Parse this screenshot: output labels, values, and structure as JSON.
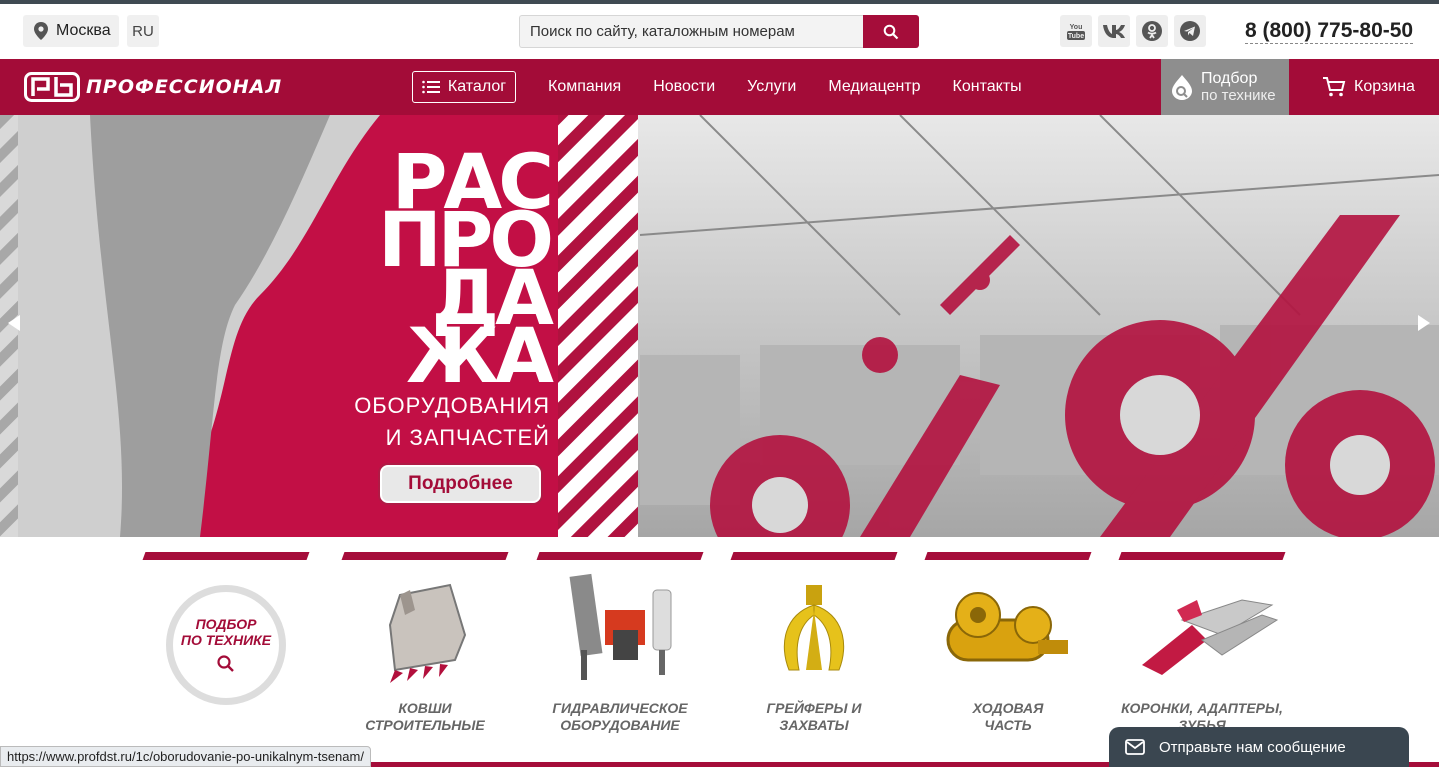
{
  "topbar": {
    "city": "Москва",
    "lang": "RU",
    "search_placeholder": "Поиск по сайту, каталожным номерам",
    "socials": [
      "youtube-icon",
      "vk-icon",
      "odnoklassniki-icon",
      "telegram-icon"
    ],
    "phone": "8 (800) 775-80-50"
  },
  "nav": {
    "logo_text": "ПРОФЕССИОНАЛ",
    "catalog": "Каталог",
    "menu": [
      "Компания",
      "Новости",
      "Услуги",
      "Медиацентр",
      "Контакты"
    ],
    "podbor_line1": "Подбор",
    "podbor_line2": "по технике",
    "cart": "Корзина"
  },
  "hero": {
    "line1": "РАС",
    "line2": "ПРО",
    "line3": "ДА",
    "line4": "ЖА",
    "sub1": "ОБОРУДОВАНИЯ",
    "sub2": "И ЗАПЧАСТЕЙ",
    "button": "Подробнее"
  },
  "categories": {
    "podbor_l1": "ПОДБОР",
    "podbor_l2": "ПО ТЕХНИКЕ",
    "items": [
      {
        "l1": "КОВШИ",
        "l2": "СТРОИТЕЛЬНЫЕ"
      },
      {
        "l1": "ГИДРАВЛИЧЕСКОЕ",
        "l2": "ОБОРУДОВАНИЕ"
      },
      {
        "l1": "ГРЕЙФЕРЫ И",
        "l2": "ЗАХВАТЫ"
      },
      {
        "l1": "ХОДОВАЯ",
        "l2": "ЧАСТЬ"
      },
      {
        "l1": "КОРОНКИ, АДАПТЕРЫ,",
        "l2": "ЗУБЬЯ"
      }
    ]
  },
  "status_url": "https://www.profdst.ru/1c/oborudovanie-po-unikalnym-tsenam/",
  "chat_label": "Отправьте нам сообщение",
  "colors": {
    "brand": "#a30c38",
    "gray": "#8e8e8e",
    "chat": "#3a4650"
  }
}
